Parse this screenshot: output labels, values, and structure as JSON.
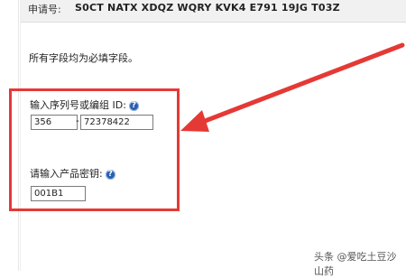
{
  "appbar": {
    "label": "申请号:",
    "value": "S0CT NATX XDQZ WQRY KVK4 E791 19JG T03Z"
  },
  "note": "所有字段均为必填字段。",
  "serial": {
    "label": "输入序列号或编组 ID:",
    "part1": "356",
    "separator": "-",
    "part2": "72378422"
  },
  "product_key": {
    "label": "请输入产品密钥:",
    "value": "001B1"
  },
  "help_icon_glyph": "?",
  "colors": {
    "highlight": "#e53935",
    "help_icon": "#2a5fb0"
  },
  "watermark": "头条 @爱吃土豆沙山药"
}
